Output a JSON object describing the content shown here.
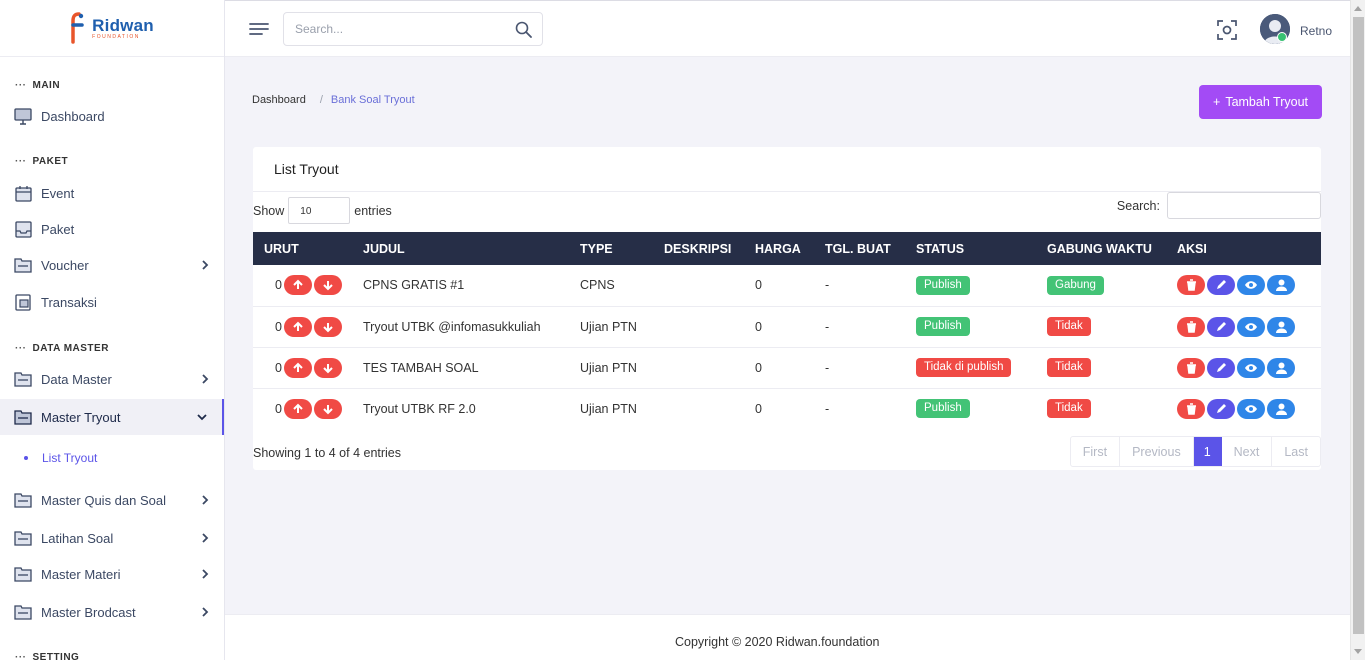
{
  "brand": {
    "name": "Ridwan",
    "sub": "FOUNDATION"
  },
  "sidebar": {
    "sections": [
      {
        "title": "MAIN"
      },
      {
        "title": "PAKET"
      },
      {
        "title": "DATA MASTER"
      },
      {
        "title": "SETTING"
      }
    ],
    "items": {
      "dashboard": "Dashboard",
      "event": "Event",
      "paket": "Paket",
      "voucher": "Voucher",
      "transaksi": "Transaksi",
      "data_master": "Data Master",
      "master_tryout": "Master Tryout",
      "list_tryout": "List Tryout",
      "master_quis": "Master Quis dan Soal",
      "latihan_soal": "Latihan Soal",
      "master_materi": "Master Materi",
      "master_brodcast": "Master Brodcast"
    }
  },
  "header": {
    "search_placeholder": "Search...",
    "username": "Retno"
  },
  "breadcrumb": {
    "home": "Dashboard",
    "current": "Bank Soal Tryout"
  },
  "add_button": "Tambah Tryout",
  "card": {
    "title": "List Tryout",
    "show_label": "Show",
    "entries_value": "10",
    "entries_label": "entries",
    "search_label": "Search:"
  },
  "table": {
    "columns": [
      "URUT",
      "JUDUL",
      "TYPE",
      "DESKRIPSI",
      "HARGA",
      "TGL. BUAT",
      "STATUS",
      "GABUNG WAKTU",
      "AKSI"
    ],
    "rows": [
      {
        "urut": "0",
        "judul": "CPNS GRATIS #1",
        "type": "CPNS",
        "deskripsi": "",
        "harga": "0",
        "tgl": "-",
        "status": "Publish",
        "gabung": "Gabung"
      },
      {
        "urut": "0",
        "judul": "Tryout UTBK @infomasukkuliah",
        "type": "Ujian PTN",
        "deskripsi": "",
        "harga": "0",
        "tgl": "-",
        "status": "Publish",
        "gabung": "Tidak"
      },
      {
        "urut": "0",
        "judul": "TES TAMBAH SOAL",
        "type": "Ujian PTN",
        "deskripsi": "",
        "harga": "0",
        "tgl": "-",
        "status": "Tidak di publish",
        "gabung": "Tidak"
      },
      {
        "urut": "0",
        "judul": "Tryout UTBK RF 2.0",
        "type": "Ujian PTN",
        "deskripsi": "",
        "harga": "0",
        "tgl": "-",
        "status": "Publish",
        "gabung": "Tidak"
      }
    ],
    "info": "Showing 1 to 4 of 4 entries"
  },
  "pagination": {
    "first": "First",
    "previous": "Previous",
    "current": "1",
    "next": "Next",
    "last": "Last"
  },
  "footer": "Copyright © 2020 Ridwan.foundation",
  "colors": {
    "accent": "#5b54e8",
    "add_button": "#a34bf5",
    "table_head": "#262e47",
    "danger": "#f04a45",
    "success": "#43c376",
    "info": "#2f86e8"
  }
}
